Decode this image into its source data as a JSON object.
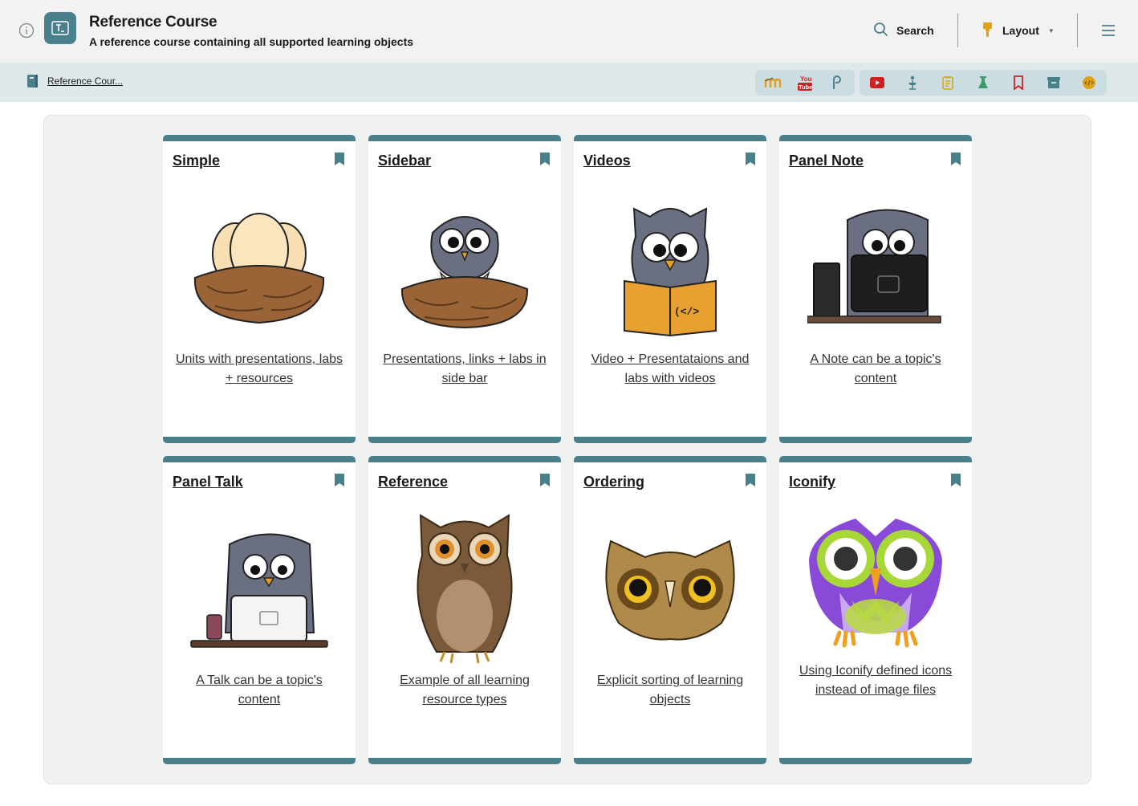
{
  "header": {
    "title": "Reference Course",
    "subtitle": "A reference course containing all supported learning objects",
    "search_label": "Search",
    "layout_label": "Layout",
    "accent_color": "#4a7f8c"
  },
  "breadcrumb": {
    "label": "Reference Cour..."
  },
  "toolbar": {
    "group_1_icons": [
      "moodle-icon",
      "youtube-icon",
      "p-icon"
    ],
    "group_2_icons": [
      "video-icon",
      "presentation-icon",
      "note-icon",
      "lab-icon",
      "bookmark-icon",
      "archive-icon",
      "code-icon"
    ]
  },
  "cards": [
    {
      "title": "Simple",
      "description": "Units with presentations, labs + resources",
      "image": "owl-egg-nest"
    },
    {
      "title": "Sidebar",
      "description": "Presentations, links + labs in side bar",
      "image": "baby-owl-in-nest"
    },
    {
      "title": "Videos",
      "description": "Video + Presentataions and labs with videos",
      "image": "owl-reading-book"
    },
    {
      "title": "Panel Note",
      "description": "A Note can be a topic's content",
      "image": "owl-at-desktop"
    },
    {
      "title": "Panel Talk",
      "description": "A Talk can be a topic's content",
      "image": "owl-with-laptop"
    },
    {
      "title": "Reference",
      "description": "Example of all learning resource types",
      "image": "realistic-owl"
    },
    {
      "title": "Ordering",
      "description": "Explicit sorting of learning objects",
      "image": "owl-face"
    },
    {
      "title": "Iconify",
      "description": "Using Iconify defined icons instead of image files",
      "image": "purple-owl"
    }
  ]
}
